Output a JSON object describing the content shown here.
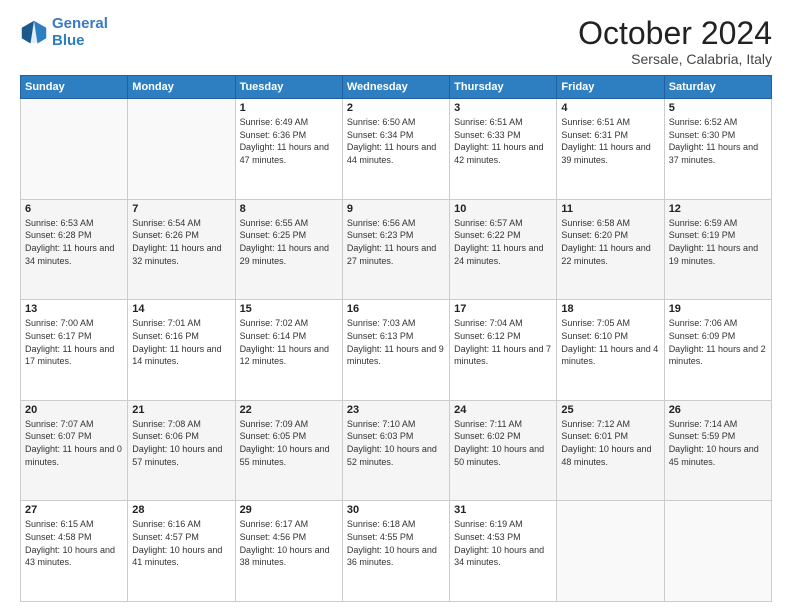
{
  "logo": {
    "line1": "General",
    "line2": "Blue"
  },
  "title": "October 2024",
  "subtitle": "Sersale, Calabria, Italy",
  "weekdays": [
    "Sunday",
    "Monday",
    "Tuesday",
    "Wednesday",
    "Thursday",
    "Friday",
    "Saturday"
  ],
  "weeks": [
    [
      {
        "day": "",
        "sunrise": "",
        "sunset": "",
        "daylight": ""
      },
      {
        "day": "",
        "sunrise": "",
        "sunset": "",
        "daylight": ""
      },
      {
        "day": "1",
        "sunrise": "Sunrise: 6:49 AM",
        "sunset": "Sunset: 6:36 PM",
        "daylight": "Daylight: 11 hours and 47 minutes."
      },
      {
        "day": "2",
        "sunrise": "Sunrise: 6:50 AM",
        "sunset": "Sunset: 6:34 PM",
        "daylight": "Daylight: 11 hours and 44 minutes."
      },
      {
        "day": "3",
        "sunrise": "Sunrise: 6:51 AM",
        "sunset": "Sunset: 6:33 PM",
        "daylight": "Daylight: 11 hours and 42 minutes."
      },
      {
        "day": "4",
        "sunrise": "Sunrise: 6:51 AM",
        "sunset": "Sunset: 6:31 PM",
        "daylight": "Daylight: 11 hours and 39 minutes."
      },
      {
        "day": "5",
        "sunrise": "Sunrise: 6:52 AM",
        "sunset": "Sunset: 6:30 PM",
        "daylight": "Daylight: 11 hours and 37 minutes."
      }
    ],
    [
      {
        "day": "6",
        "sunrise": "Sunrise: 6:53 AM",
        "sunset": "Sunset: 6:28 PM",
        "daylight": "Daylight: 11 hours and 34 minutes."
      },
      {
        "day": "7",
        "sunrise": "Sunrise: 6:54 AM",
        "sunset": "Sunset: 6:26 PM",
        "daylight": "Daylight: 11 hours and 32 minutes."
      },
      {
        "day": "8",
        "sunrise": "Sunrise: 6:55 AM",
        "sunset": "Sunset: 6:25 PM",
        "daylight": "Daylight: 11 hours and 29 minutes."
      },
      {
        "day": "9",
        "sunrise": "Sunrise: 6:56 AM",
        "sunset": "Sunset: 6:23 PM",
        "daylight": "Daylight: 11 hours and 27 minutes."
      },
      {
        "day": "10",
        "sunrise": "Sunrise: 6:57 AM",
        "sunset": "Sunset: 6:22 PM",
        "daylight": "Daylight: 11 hours and 24 minutes."
      },
      {
        "day": "11",
        "sunrise": "Sunrise: 6:58 AM",
        "sunset": "Sunset: 6:20 PM",
        "daylight": "Daylight: 11 hours and 22 minutes."
      },
      {
        "day": "12",
        "sunrise": "Sunrise: 6:59 AM",
        "sunset": "Sunset: 6:19 PM",
        "daylight": "Daylight: 11 hours and 19 minutes."
      }
    ],
    [
      {
        "day": "13",
        "sunrise": "Sunrise: 7:00 AM",
        "sunset": "Sunset: 6:17 PM",
        "daylight": "Daylight: 11 hours and 17 minutes."
      },
      {
        "day": "14",
        "sunrise": "Sunrise: 7:01 AM",
        "sunset": "Sunset: 6:16 PM",
        "daylight": "Daylight: 11 hours and 14 minutes."
      },
      {
        "day": "15",
        "sunrise": "Sunrise: 7:02 AM",
        "sunset": "Sunset: 6:14 PM",
        "daylight": "Daylight: 11 hours and 12 minutes."
      },
      {
        "day": "16",
        "sunrise": "Sunrise: 7:03 AM",
        "sunset": "Sunset: 6:13 PM",
        "daylight": "Daylight: 11 hours and 9 minutes."
      },
      {
        "day": "17",
        "sunrise": "Sunrise: 7:04 AM",
        "sunset": "Sunset: 6:12 PM",
        "daylight": "Daylight: 11 hours and 7 minutes."
      },
      {
        "day": "18",
        "sunrise": "Sunrise: 7:05 AM",
        "sunset": "Sunset: 6:10 PM",
        "daylight": "Daylight: 11 hours and 4 minutes."
      },
      {
        "day": "19",
        "sunrise": "Sunrise: 7:06 AM",
        "sunset": "Sunset: 6:09 PM",
        "daylight": "Daylight: 11 hours and 2 minutes."
      }
    ],
    [
      {
        "day": "20",
        "sunrise": "Sunrise: 7:07 AM",
        "sunset": "Sunset: 6:07 PM",
        "daylight": "Daylight: 11 hours and 0 minutes."
      },
      {
        "day": "21",
        "sunrise": "Sunrise: 7:08 AM",
        "sunset": "Sunset: 6:06 PM",
        "daylight": "Daylight: 10 hours and 57 minutes."
      },
      {
        "day": "22",
        "sunrise": "Sunrise: 7:09 AM",
        "sunset": "Sunset: 6:05 PM",
        "daylight": "Daylight: 10 hours and 55 minutes."
      },
      {
        "day": "23",
        "sunrise": "Sunrise: 7:10 AM",
        "sunset": "Sunset: 6:03 PM",
        "daylight": "Daylight: 10 hours and 52 minutes."
      },
      {
        "day": "24",
        "sunrise": "Sunrise: 7:11 AM",
        "sunset": "Sunset: 6:02 PM",
        "daylight": "Daylight: 10 hours and 50 minutes."
      },
      {
        "day": "25",
        "sunrise": "Sunrise: 7:12 AM",
        "sunset": "Sunset: 6:01 PM",
        "daylight": "Daylight: 10 hours and 48 minutes."
      },
      {
        "day": "26",
        "sunrise": "Sunrise: 7:14 AM",
        "sunset": "Sunset: 5:59 PM",
        "daylight": "Daylight: 10 hours and 45 minutes."
      }
    ],
    [
      {
        "day": "27",
        "sunrise": "Sunrise: 6:15 AM",
        "sunset": "Sunset: 4:58 PM",
        "daylight": "Daylight: 10 hours and 43 minutes."
      },
      {
        "day": "28",
        "sunrise": "Sunrise: 6:16 AM",
        "sunset": "Sunset: 4:57 PM",
        "daylight": "Daylight: 10 hours and 41 minutes."
      },
      {
        "day": "29",
        "sunrise": "Sunrise: 6:17 AM",
        "sunset": "Sunset: 4:56 PM",
        "daylight": "Daylight: 10 hours and 38 minutes."
      },
      {
        "day": "30",
        "sunrise": "Sunrise: 6:18 AM",
        "sunset": "Sunset: 4:55 PM",
        "daylight": "Daylight: 10 hours and 36 minutes."
      },
      {
        "day": "31",
        "sunrise": "Sunrise: 6:19 AM",
        "sunset": "Sunset: 4:53 PM",
        "daylight": "Daylight: 10 hours and 34 minutes."
      },
      {
        "day": "",
        "sunrise": "",
        "sunset": "",
        "daylight": ""
      },
      {
        "day": "",
        "sunrise": "",
        "sunset": "",
        "daylight": ""
      }
    ]
  ]
}
